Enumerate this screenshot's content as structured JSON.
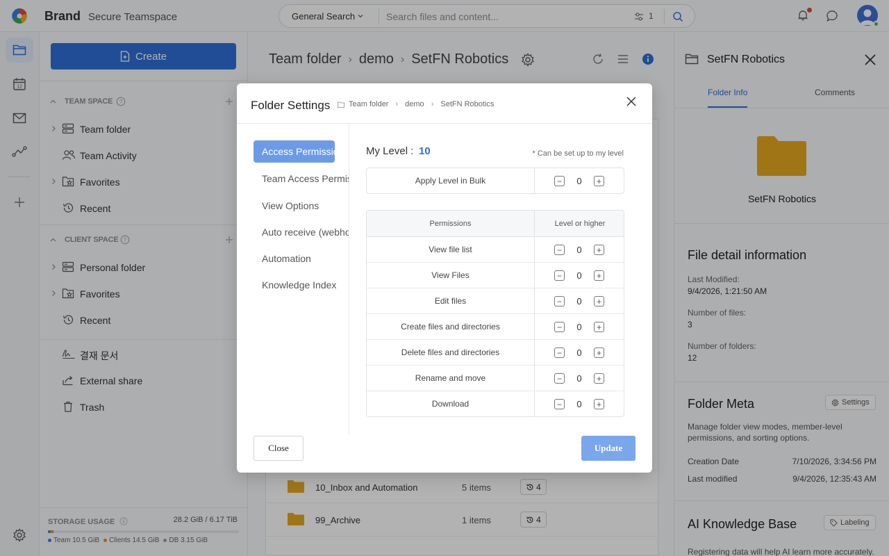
{
  "header": {
    "brand": "Brand",
    "space_name": "Secure Teamspace",
    "search_scope": "General Search",
    "search_placeholder": "Search files and content...",
    "filter_count": "1"
  },
  "sidebar": {
    "create_label": "Create",
    "team_space_title": "TEAM SPACE",
    "team_items": [
      "Team folder",
      "Team Activity",
      "Favorites",
      "Recent"
    ],
    "client_space_title": "CLIENT SPACE",
    "client_items": [
      "Personal folder",
      "Favorites",
      "Recent"
    ],
    "extra_items": [
      "결재 문서",
      "External share",
      "Trash"
    ],
    "storage": {
      "title": "STORAGE USAGE",
      "value": "28.2 GiB / 6.17 TiB",
      "team": "Team 10.5 GiB",
      "clients": "Clients 14.5 GiB",
      "db": "DB 3.15 GiB",
      "team_fraction": 0.0017,
      "clients_fraction": 0.0023,
      "db_fraction": 0.0005,
      "colors": {
        "team": "#3b7be0",
        "clients": "#f08a24",
        "db": "#9aa0a6"
      }
    }
  },
  "main": {
    "breadcrumb": [
      "Team folder",
      "demo",
      "SetFN Robotics"
    ],
    "files": [
      {
        "name": "10_Inbox and Automation",
        "count": "5 items",
        "versions": "4"
      },
      {
        "name": "99_Archive",
        "count": "1 items",
        "versions": "4"
      }
    ]
  },
  "right_panel": {
    "title": "SetFN Robotics",
    "tabs": [
      "Folder Info",
      "Comments"
    ],
    "folder_name": "SetFN Robotics",
    "detail_title": "File detail information",
    "last_modified_label": "Last Modified:",
    "last_modified_value": "9/4/2026, 1:21:50 AM",
    "files_label": "Number of files:",
    "files_value": "3",
    "folders_label": "Number of folders:",
    "folders_value": "12",
    "meta_title": "Folder Meta",
    "meta_button": "Settings",
    "meta_desc": "Manage folder view modes, member-level permissions, and sorting options.",
    "creation_label": "Creation Date",
    "creation_value": "7/10/2026, 3:34:56 PM",
    "modified_label": "Last modified",
    "modified_value": "9/4/2026, 12:35:43 AM",
    "ai_title": "AI Knowledge Base",
    "ai_button": "Labeling",
    "ai_desc": "Registering data will help AI learn more accurately."
  },
  "modal": {
    "title": "Folder Settings",
    "breadcrumb": [
      "Team folder",
      "demo",
      "SetFN Robotics"
    ],
    "nav": [
      "Access Permission",
      "Team Access Permissions",
      "View Options",
      "Auto receive (webhook)",
      "Automation",
      "Knowledge Index"
    ],
    "my_level_label": "My Level :",
    "my_level_value": "10",
    "note": "* Can be set up to my level",
    "bulk_label": "Apply Level in Bulk",
    "bulk_value": "0",
    "col_permissions": "Permissions",
    "col_level": "Level or higher",
    "permissions": [
      {
        "label": "View file list",
        "value": "0"
      },
      {
        "label": "View Files",
        "value": "0"
      },
      {
        "label": "Edit files",
        "value": "0"
      },
      {
        "label": "Create files and directories",
        "value": "0"
      },
      {
        "label": "Delete files and directories",
        "value": "0"
      },
      {
        "label": "Rename and move",
        "value": "0"
      },
      {
        "label": "Download",
        "value": "0"
      }
    ],
    "close_label": "Close",
    "update_label": "Update"
  },
  "colors": {
    "accent": "#2f6fd6",
    "folder": "#e5a81f",
    "update_button": "#7aa6ec"
  }
}
